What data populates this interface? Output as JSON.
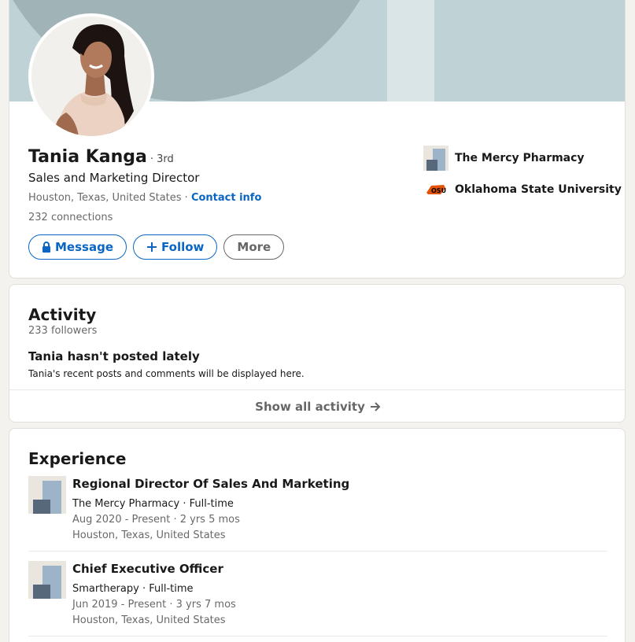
{
  "profile": {
    "name": "Tania Kanga",
    "degree": "· 3rd",
    "headline": "Sales and Marketing Director",
    "location": "Houston, Texas, United States",
    "location_sep": " · ",
    "contact_label": "Contact info",
    "connections": "232 connections"
  },
  "actions": {
    "message_label": "Message",
    "follow_label": "Follow",
    "more_label": "More"
  },
  "side": {
    "company": "The Mercy Pharmacy",
    "school": "Oklahoma State University"
  },
  "activity": {
    "title": "Activity",
    "followers": "233 followers",
    "empty_heading": "Tania hasn't posted lately",
    "empty_text": "Tania's recent posts and comments will be displayed here.",
    "show_all": "Show all activity"
  },
  "experience": {
    "title": "Experience",
    "items": [
      {
        "title": "Regional Director Of Sales And Marketing",
        "company": "The Mercy Pharmacy · Full-time",
        "dates": "Aug 2020 - Present · 2 yrs 5 mos",
        "location": "Houston, Texas, United States"
      },
      {
        "title": "Chief Executive Officer",
        "company": "Smartherapy · Full-time",
        "dates": "Jun 2019 - Present · 3 yrs 7 mos",
        "location": "Houston, Texas, United States"
      }
    ]
  },
  "colors": {
    "link": "#0a66c2",
    "banner": "#bfd3d6",
    "banner_shape": "#a0b3b6",
    "osu_orange": "#e35205"
  },
  "icons": {
    "message": "lock-icon",
    "follow": "plus-icon",
    "show_all": "arrow-right-icon",
    "school": "osu-logo"
  }
}
